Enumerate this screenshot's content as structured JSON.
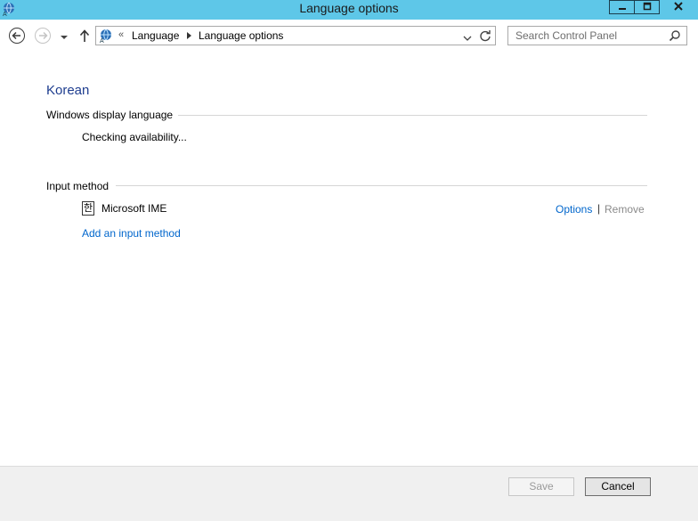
{
  "window": {
    "title": "Language options"
  },
  "nav": {
    "breadcrumb": {
      "overflow": "«",
      "items": [
        "Language",
        "Language options"
      ]
    },
    "search": {
      "placeholder": "Search Control Panel"
    }
  },
  "content": {
    "language_name": "Korean",
    "display_language": {
      "heading": "Windows display language",
      "status": "Checking availability..."
    },
    "input_method": {
      "heading": "Input method",
      "items": [
        {
          "glyph": "한",
          "name": "Microsoft IME",
          "options_label": "Options",
          "separator": "|",
          "remove_label": "Remove"
        }
      ],
      "add_label": "Add an input method"
    }
  },
  "footer": {
    "save_label": "Save",
    "cancel_label": "Cancel"
  },
  "colors": {
    "titlebar": "#5ec7e8",
    "link": "#0066cc",
    "heading": "#1e3d8f",
    "disabled_text": "#8a8a8a"
  },
  "icons": [
    "language-control-panel-icon",
    "minimize-icon",
    "maximize-icon",
    "close-icon",
    "back-arrow-icon",
    "forward-arrow-icon",
    "chevron-down-icon",
    "up-arrow-icon",
    "refresh-icon",
    "search-icon"
  ]
}
